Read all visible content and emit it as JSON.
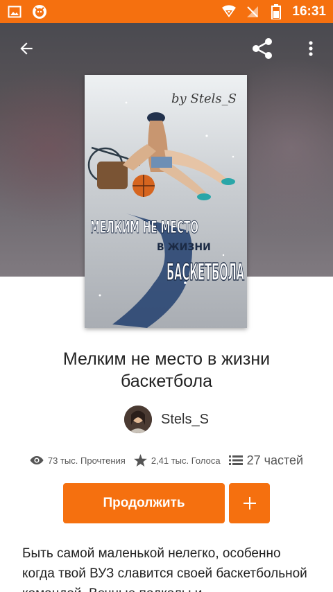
{
  "status_bar": {
    "time": "16:31",
    "left_icons": [
      "image-icon",
      "app-notification-icon"
    ],
    "right_icons": [
      "wifi-icon",
      "no-signal-icon",
      "battery-icon"
    ]
  },
  "header": {
    "back_icon": "arrow-back-icon",
    "share_icon": "share-icon",
    "more_icon": "more-vert-icon"
  },
  "cover": {
    "signature": "by Stels_S",
    "line1": "МЕЛКИМ НЕ МЕСТО",
    "line2": "В ЖИЗНИ",
    "line3": "БАСКЕТБОЛА"
  },
  "story": {
    "title": "Мелким не место в жизни баскетбола",
    "author": "Stels_S"
  },
  "stats": {
    "reads": "73 тыс. Прочтения",
    "votes": "2,41 тыс. Голоса",
    "parts": "27 частей"
  },
  "actions": {
    "continue_label": "Продолжить",
    "add_label": "+"
  },
  "description": "Быть самой маленькой нелегко, особенно когда твой ВУЗ славится своей баскетбольной командой. Вечные подколы и",
  "colors": {
    "accent": "#f5700f",
    "text": "#222222"
  }
}
